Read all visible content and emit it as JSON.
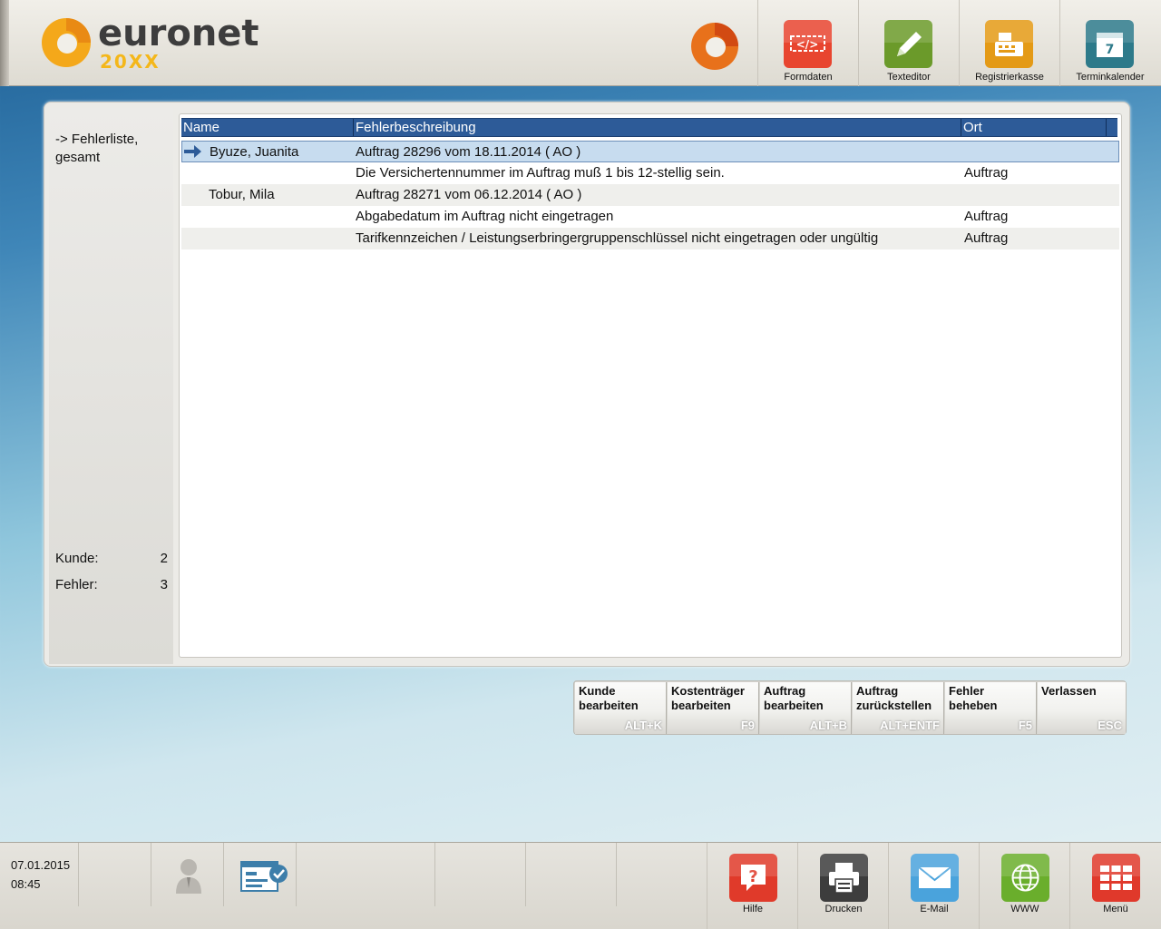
{
  "app": {
    "logo_word": "euronet",
    "logo_sub": "20XX"
  },
  "toolbar": [
    {
      "label": "Formdaten",
      "icon": "form-data-icon",
      "color": "#e8452f"
    },
    {
      "label": "Texteditor",
      "icon": "pencil-icon",
      "color": "#6b9a2a"
    },
    {
      "label": "Registrierkasse",
      "icon": "cash-register-icon",
      "color": "#e49a16"
    },
    {
      "label": "Terminkalender",
      "icon": "calendar-icon",
      "color": "#2d7a8a",
      "day": "7"
    }
  ],
  "sidebar": {
    "title": "-> Fehlerliste, gesamt",
    "kunde_label": "Kunde:",
    "kunde_value": "2",
    "fehler_label": "Fehler:",
    "fehler_value": "3"
  },
  "table": {
    "columns": [
      "Name",
      "Fehlerbeschreibung",
      "Ort"
    ],
    "rows": [
      {
        "name": "Byuze, Juanita",
        "desc": "Auftrag 28296 vom 18.11.2014 ( AO )",
        "ort": "",
        "selected": true
      },
      {
        "name": "",
        "desc": "Die Versichertennummer im Auftrag muß 1 bis 12-stellig sein.",
        "ort": "Auftrag"
      },
      {
        "name": "Tobur, Mila",
        "desc": "Auftrag 28271 vom 06.12.2014 ( AO )",
        "ort": ""
      },
      {
        "name": "",
        "desc": "Abgabedatum im Auftrag nicht eingetragen",
        "ort": "Auftrag"
      },
      {
        "name": "",
        "desc": "Tarifkennzeichen / Leistungserbringergruppenschlüssel nicht eingetragen oder ungültig",
        "ort": "Auftrag"
      }
    ]
  },
  "actions": [
    {
      "line1": "Kunde",
      "line2": "bearbeiten",
      "key": "ALT+K"
    },
    {
      "line1": "Kostenträger",
      "line2": "bearbeiten",
      "key": "F9"
    },
    {
      "line1": "Auftrag",
      "line2": "bearbeiten",
      "key": "ALT+B"
    },
    {
      "line1": "Auftrag",
      "line2": "zurückstellen",
      "key": "ALT+ENTF"
    },
    {
      "line1": "Fehler",
      "line2": "beheben",
      "key": "F5"
    },
    {
      "line1": "Verlassen",
      "line2": "",
      "key": "ESC"
    }
  ],
  "status": {
    "date": "07.01.2015",
    "time": "08:45"
  },
  "bottom_buttons": [
    {
      "label": "Hilfe",
      "icon": "help-icon",
      "color": "#e03a2a"
    },
    {
      "label": "Drucken",
      "icon": "printer-icon",
      "color": "#3d3d3d"
    },
    {
      "label": "E-Mail",
      "icon": "email-icon",
      "color": "#4aa3dc"
    },
    {
      "label": "WWW",
      "icon": "globe-icon",
      "color": "#6aae2c"
    },
    {
      "label": "Menü",
      "icon": "menu-grid-icon",
      "color": "#e0392b"
    }
  ]
}
